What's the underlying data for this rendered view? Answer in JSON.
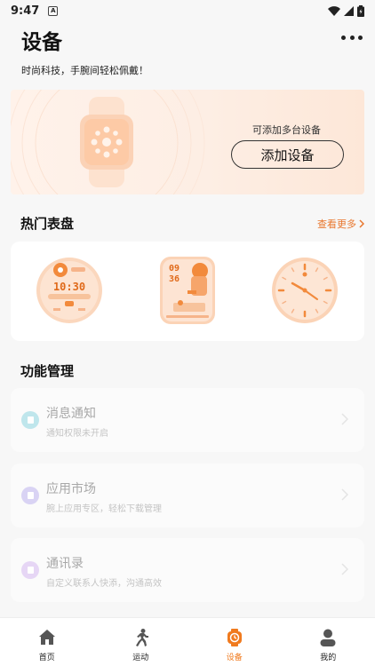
{
  "status_bar": {
    "time": "9:47",
    "notification_badge": "A"
  },
  "header": {
    "title": "设备",
    "subtitle": "时尚科技，手腕间轻松佩戴！"
  },
  "banner": {
    "hint": "可添加多台设备",
    "button_label": "添加设备"
  },
  "hot_faces": {
    "title": "热门表盘",
    "see_more": "查看更多",
    "faces": [
      {
        "name": "watch-face-digital",
        "time": "10:30"
      },
      {
        "name": "watch-face-character",
        "time_hour": "09",
        "time_minute": "36"
      },
      {
        "name": "watch-face-analog"
      }
    ]
  },
  "functions": {
    "title": "功能管理",
    "items": [
      {
        "title": "消息通知",
        "desc": "通知权限未开启",
        "icon": "message-icon",
        "color": "#bfe6ec"
      },
      {
        "title": "应用市场",
        "desc": "腕上应用专区，轻松下载管理",
        "icon": "app-market-icon",
        "color": "#d9d3f4"
      },
      {
        "title": "通讯录",
        "desc": "自定义联系人快添，沟通高效",
        "icon": "contacts-icon",
        "color": "#e6d6f5"
      }
    ]
  },
  "nav": {
    "items": [
      {
        "label": "首页",
        "icon": "home-icon"
      },
      {
        "label": "运动",
        "icon": "run-icon"
      },
      {
        "label": "设备",
        "icon": "watch-icon",
        "active": true
      },
      {
        "label": "我的",
        "icon": "profile-icon"
      }
    ]
  },
  "colors": {
    "accent": "#f07a1e",
    "link": "#e8772e"
  }
}
